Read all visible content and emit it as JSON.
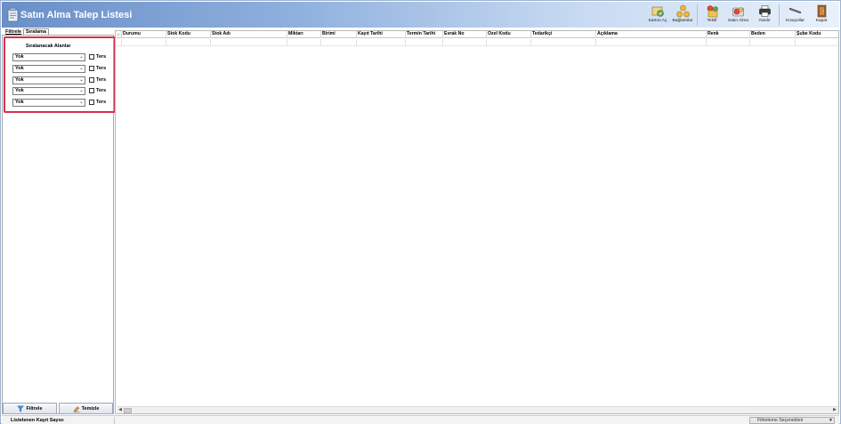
{
  "window": {
    "title": "Satın Alma Talep Listesi"
  },
  "toolbar": {
    "buttons": [
      {
        "label": "Kartını Aç",
        "icon": "open-card-icon"
      },
      {
        "label": "Bağlantılar",
        "icon": "links-icon"
      },
      {
        "label": "Teklif",
        "icon": "offer-icon"
      },
      {
        "label": "Satın Alma",
        "icon": "purchase-icon"
      },
      {
        "label": "Yazdır",
        "icon": "print-icon"
      },
      {
        "label": "Kısayollar",
        "icon": "shortcuts-icon"
      },
      {
        "label": "Kapat",
        "icon": "close-door-icon"
      }
    ]
  },
  "tabs": [
    {
      "label": "Filtrele"
    },
    {
      "label": "Sıralama"
    }
  ],
  "sort_panel": {
    "title": "Sıralanacak Alanlar",
    "rows": [
      {
        "value": "Yok",
        "checkbox_label": "Ters",
        "checked": false
      },
      {
        "value": "Yok",
        "checkbox_label": "Ters",
        "checked": false
      },
      {
        "value": "Yok",
        "checkbox_label": "Ters",
        "checked": false
      },
      {
        "value": "Yok",
        "checkbox_label": "Ters",
        "checked": false
      },
      {
        "value": "Yok",
        "checkbox_label": "Ters",
        "checked": false
      }
    ]
  },
  "buttons": {
    "filter_label": "Filtrele",
    "clear_label": "Temizle"
  },
  "grid": {
    "columns": [
      "Durumu",
      "Stok Kodu",
      "Stok Adı",
      "Miktarı",
      "Birimi",
      "Kayıt Tarihi",
      "Termin Tarihi",
      "Evrak No",
      "Özel Kodu",
      "Tedarikçi",
      "Açıklama",
      "Renk",
      "Beden",
      "Şube Kodu"
    ]
  },
  "status": {
    "record_count_label": "Listelenen Kayıt Sayısı",
    "filter_options_label": "Filtreleme Seçenekleri"
  },
  "colors": {
    "title_gradient_start": "#6a8fc8",
    "highlight_border": "#d9304c"
  }
}
